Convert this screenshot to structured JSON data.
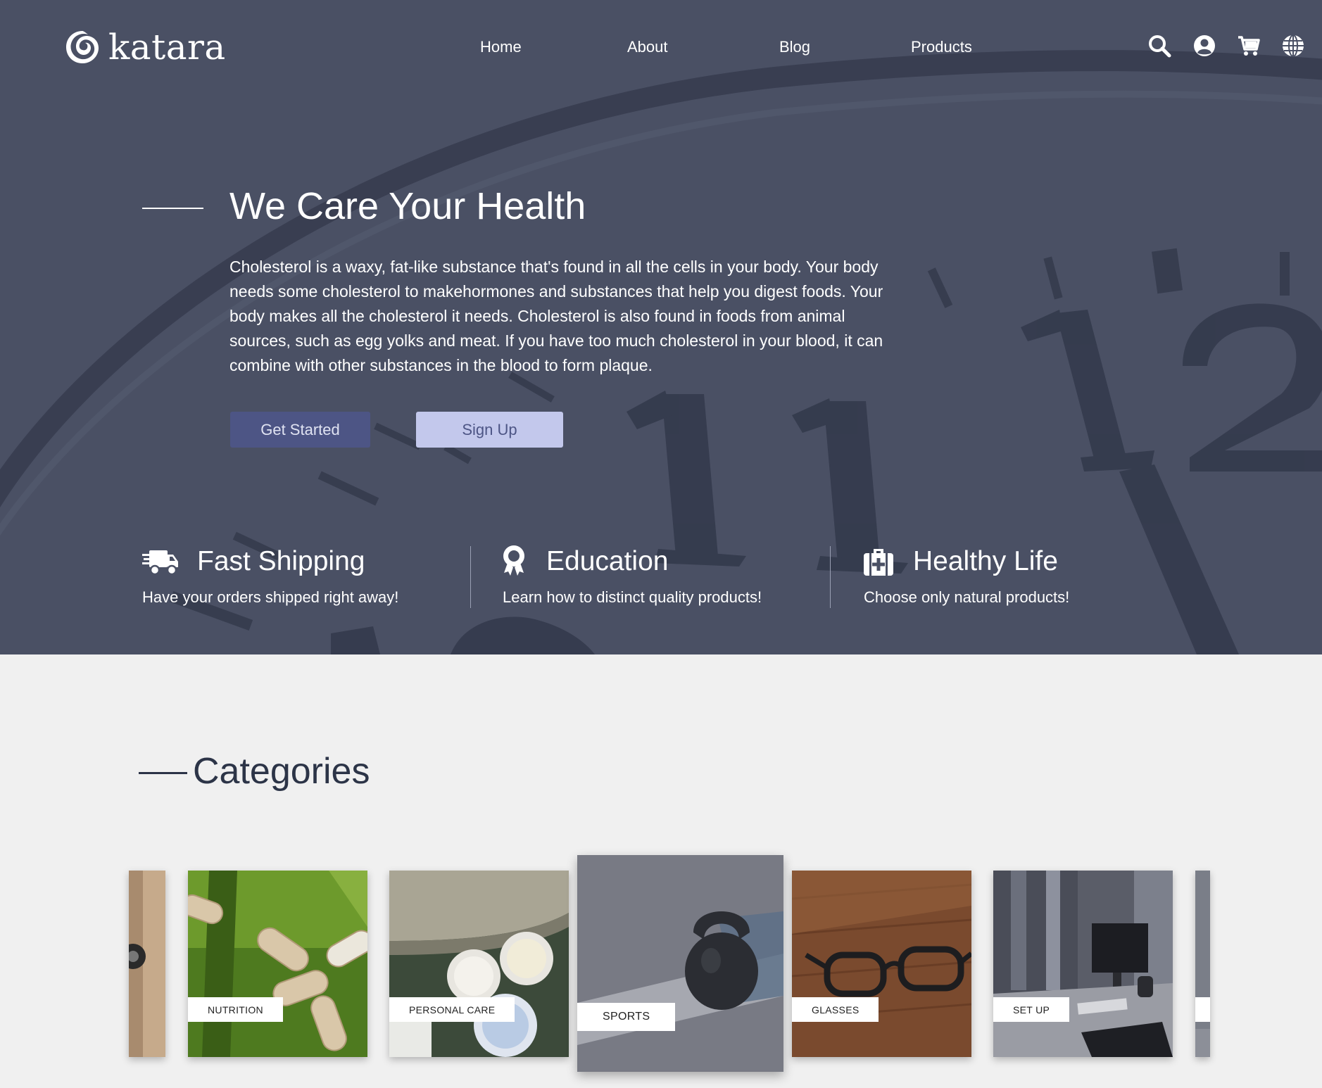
{
  "brand": {
    "name": "katara"
  },
  "nav": {
    "links": [
      "Home",
      "About",
      "Blog",
      "Products"
    ],
    "icons": [
      "search-icon",
      "user-icon",
      "cart-icon",
      "globe-icon"
    ]
  },
  "hero": {
    "title": "We Care Your Health",
    "text": "Cholesterol is a waxy, fat-like substance that's found in all the cells in your body. Your body needs some cholesterol to makehormones and substances that help you digest foods. Your body makes all the cholesterol it needs. Cholesterol is also found in foods from animal sources, such as egg yolks and meat. If you have too much cholesterol in your blood, it can combine with other substances in the blood to form plaque.",
    "primary_button": "Get Started",
    "secondary_button": "Sign Up"
  },
  "features": [
    {
      "icon": "truck-icon",
      "title": "Fast Shipping",
      "desc": "Have your orders shipped right away!"
    },
    {
      "icon": "award-icon",
      "title": "Education",
      "desc": "Learn how to distinct quality products!"
    },
    {
      "icon": "first-aid-kit-icon",
      "title": "Healthy Life",
      "desc": "Choose only natural products!"
    }
  ],
  "categories": {
    "title": "Categories",
    "items": [
      "NUTRITION",
      "PERSONAL CARE",
      "SPORTS",
      "GLASSES",
      "SET UP"
    ],
    "active": "SPORTS"
  },
  "colors": {
    "hero_bg": "#4a5064",
    "primary_button": "#4d5585",
    "secondary_button": "#c3c8ec",
    "page_bg": "#f0f0f0",
    "heading_dark": "#2c3447"
  }
}
